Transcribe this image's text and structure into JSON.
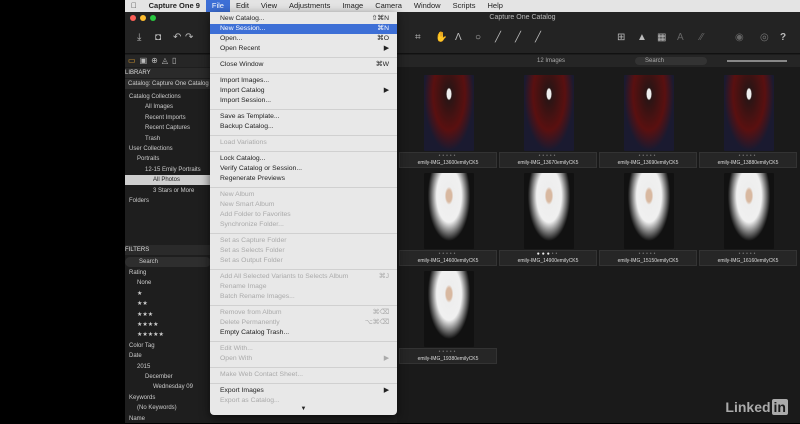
{
  "menubar": {
    "apple": "",
    "app": "Capture One 9",
    "items": [
      "File",
      "Edit",
      "View",
      "Adjustments",
      "Image",
      "Camera",
      "Window",
      "Scripts",
      "Help"
    ]
  },
  "window": {
    "title": "Capture One Catalog"
  },
  "sidebar": {
    "library": "LIBRARY",
    "catalog": "Catalog: Capture One Catalog",
    "items": [
      {
        "label": "Catalog Collections",
        "indent": 0,
        "hdr": false
      },
      {
        "label": "All Images",
        "indent": 2
      },
      {
        "label": "Recent Imports",
        "indent": 2
      },
      {
        "label": "Recent Captures",
        "indent": 2
      },
      {
        "label": "Trash",
        "indent": 2
      },
      {
        "label": "User Collections",
        "indent": 0
      },
      {
        "label": "Portraits",
        "indent": 1
      },
      {
        "label": "12-15 Emily Portraits",
        "indent": 2
      },
      {
        "label": "All Photos",
        "indent": 3,
        "selected": true
      },
      {
        "label": "3 Stars or More",
        "indent": 3
      },
      {
        "label": "Folders",
        "indent": 0
      }
    ],
    "filters": "FILTERS",
    "search_placeholder": "Search",
    "filter_items": [
      {
        "label": "Rating",
        "indent": 0
      },
      {
        "label": "None",
        "indent": 1
      },
      {
        "label": "★",
        "indent": 1
      },
      {
        "label": "★★",
        "indent": 1
      },
      {
        "label": "★★★",
        "indent": 1
      },
      {
        "label": "★★★★",
        "indent": 1
      },
      {
        "label": "★★★★★",
        "indent": 1
      },
      {
        "label": "Color Tag",
        "indent": 0
      },
      {
        "label": "Date",
        "indent": 0
      },
      {
        "label": "2015",
        "indent": 1
      },
      {
        "label": "December",
        "indent": 2
      },
      {
        "label": "Wednesday 09",
        "indent": 3
      },
      {
        "label": "Keywords",
        "indent": 0
      },
      {
        "label": "(No Keywords)",
        "indent": 1
      },
      {
        "label": "Name",
        "indent": 0
      }
    ]
  },
  "browser": {
    "count": "12 Images",
    "search_placeholder": "Search",
    "images": [
      {
        "name": "emily-IMG_13600emilyCK5",
        "tone": "dark"
      },
      {
        "name": "emily-IMG_13670emilyCK5",
        "tone": "dark"
      },
      {
        "name": "emily-IMG_13690emilyCK5",
        "tone": "dark"
      },
      {
        "name": "emily-IMG_13880emilyCK5",
        "tone": "dark"
      },
      {
        "name": "emily-IMG_14600emilyCK5",
        "tone": "white"
      },
      {
        "name": "emily-IMG_14900emilyCK5",
        "tone": "white",
        "rating": 3
      },
      {
        "name": "emily-IMG_15150emilyCK5",
        "tone": "white"
      },
      {
        "name": "emily-IMG_16160emilyCK5",
        "tone": "white"
      },
      {
        "name": "emily-IMG_19380emilyCK5",
        "tone": "white"
      }
    ]
  },
  "file_menu": [
    {
      "label": "New Catalog...",
      "shortcut": "⇧⌘N"
    },
    {
      "label": "New Session...",
      "shortcut": "⌘N",
      "highlighted": true
    },
    {
      "label": "Open...",
      "shortcut": "⌘O"
    },
    {
      "label": "Open Recent",
      "submenu": true
    },
    {
      "sep": true
    },
    {
      "label": "Close Window",
      "shortcut": "⌘W"
    },
    {
      "sep": true
    },
    {
      "label": "Import Images..."
    },
    {
      "label": "Import Catalog",
      "submenu": true
    },
    {
      "label": "Import Session..."
    },
    {
      "sep": true
    },
    {
      "label": "Save as Template..."
    },
    {
      "label": "Backup Catalog..."
    },
    {
      "sep": true
    },
    {
      "label": "Load Variations",
      "disabled": true
    },
    {
      "sep": true
    },
    {
      "label": "Lock Catalog..."
    },
    {
      "label": "Verify Catalog or Session..."
    },
    {
      "label": "Regenerate Previews"
    },
    {
      "sep": true
    },
    {
      "label": "New Album",
      "disabled": true
    },
    {
      "label": "New Smart Album",
      "disabled": true
    },
    {
      "label": "Add Folder to Favorites",
      "disabled": true
    },
    {
      "label": "Synchronize Folder...",
      "disabled": true
    },
    {
      "sep": true
    },
    {
      "label": "Set as Capture Folder",
      "disabled": true
    },
    {
      "label": "Set as Selects Folder",
      "disabled": true
    },
    {
      "label": "Set as Output Folder",
      "disabled": true
    },
    {
      "sep": true
    },
    {
      "label": "Add All Selected Variants to Selects Album",
      "shortcut": "⌘J",
      "disabled": true
    },
    {
      "label": "Rename Image",
      "disabled": true
    },
    {
      "label": "Batch Rename Images...",
      "disabled": true
    },
    {
      "sep": true
    },
    {
      "label": "Remove from Album",
      "shortcut": "⌘⌫",
      "disabled": true
    },
    {
      "label": "Delete Permanently",
      "shortcut": "⌥⌘⌫",
      "disabled": true
    },
    {
      "label": "Empty Catalog Trash..."
    },
    {
      "sep": true
    },
    {
      "label": "Edit With...",
      "disabled": true
    },
    {
      "label": "Open With",
      "submenu": true,
      "disabled": true
    },
    {
      "sep": true
    },
    {
      "label": "Make Web Contact Sheet...",
      "disabled": true
    },
    {
      "sep": true
    },
    {
      "label": "Export Images",
      "submenu": true
    },
    {
      "label": "Export as Catalog...",
      "disabled": true
    }
  ],
  "watermark": {
    "text": "Linked",
    "box": "in"
  },
  "colors": {
    "accent": "#3d6fd6",
    "background": "#1c1c1c"
  }
}
